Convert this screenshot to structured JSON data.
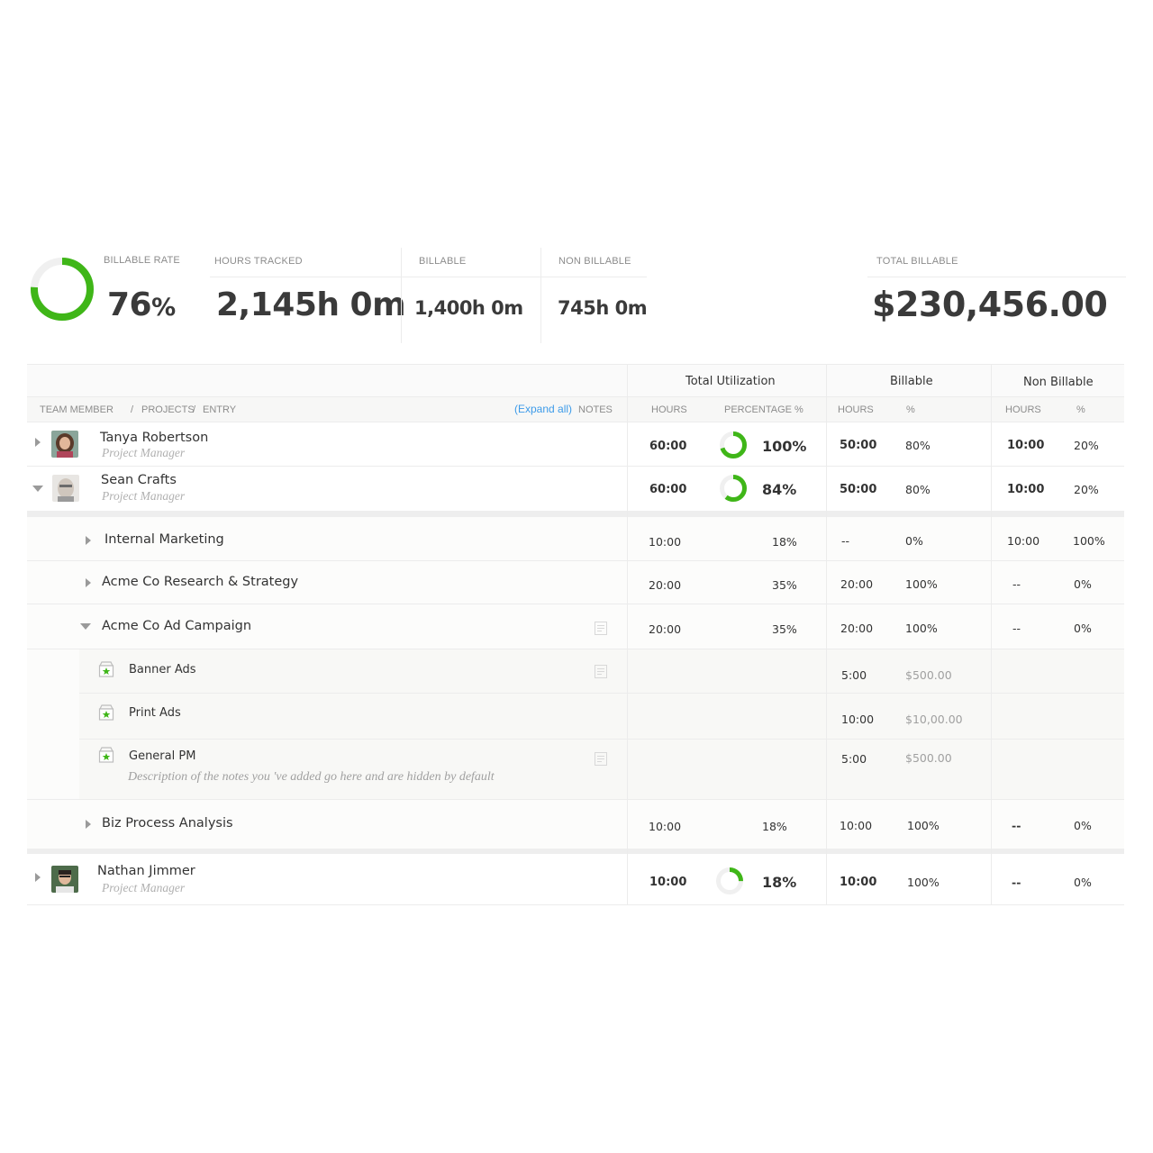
{
  "summary": {
    "billable_rate": {
      "label": "BILLABLE RATE",
      "value": "76",
      "unit": "%",
      "fraction": 0.76
    },
    "hours_tracked": {
      "label": "HOURS TRACKED",
      "value": "2,145h 0m"
    },
    "billable": {
      "label": "BILLABLE",
      "value": "1,400h 0m"
    },
    "non_billable": {
      "label": "NON BILLABLE",
      "value": "745h 0m"
    },
    "total_billable": {
      "label": "TOTAL BILLABLE",
      "value": "$230,456.00"
    }
  },
  "table": {
    "groups": {
      "total_utilization": "Total Utilization",
      "billable": "Billable",
      "non_billable": "Non Billable"
    },
    "columns": {
      "team_member": "TEAM MEMBER",
      "sep1": "/",
      "projects": "PROJECTS",
      "sep2": "/",
      "entry": "ENTRY",
      "expand_all": "(Expand all)",
      "notes": "NOTES",
      "tu_hours": "HOURS",
      "tu_percentage": "PERCENTAGE %",
      "b_hours": "HOURS",
      "b_pct": "%",
      "nb_hours": "HOURS",
      "nb_pct": "%"
    },
    "members": [
      {
        "name": "Tanya Robertson",
        "role": "Project Manager",
        "hours": "60:00",
        "pct": "100%",
        "pct_fraction": 1.0,
        "b_hours": "50:00",
        "b_pct": "80%",
        "nb_hours": "10:00",
        "nb_pct": "20%"
      },
      {
        "name": "Sean Crafts",
        "role": "Project Manager",
        "hours": "60:00",
        "pct": "84%",
        "pct_fraction": 0.84,
        "b_hours": "50:00",
        "b_pct": "80%",
        "nb_hours": "10:00",
        "nb_pct": "20%"
      },
      {
        "name": "Nathan Jimmer",
        "role": "Project Manager",
        "hours": "10:00",
        "pct": "18%",
        "pct_fraction": 0.18,
        "b_hours": "10:00",
        "b_pct": "100%",
        "nb_hours": "--",
        "nb_pct": "0%"
      }
    ],
    "projects": [
      {
        "name": "Internal Marketing",
        "hours": "10:00",
        "pct": "18%",
        "b_hours": "--",
        "b_pct": "0%",
        "nb_hours": "10:00",
        "nb_pct": "100%"
      },
      {
        "name": "Acme Co Research & Strategy",
        "hours": "20:00",
        "pct": "35%",
        "b_hours": "20:00",
        "b_pct": "100%",
        "nb_hours": "--",
        "nb_pct": "0%"
      },
      {
        "name": "Acme Co Ad Campaign",
        "hours": "20:00",
        "pct": "35%",
        "b_hours": "20:00",
        "b_pct": "100%",
        "nb_hours": "--",
        "nb_pct": "0%"
      },
      {
        "name": "Biz Process Analysis",
        "hours": "10:00",
        "pct": "18%",
        "b_hours": "10:00",
        "b_pct": "100%",
        "nb_hours": "--",
        "nb_pct": "0%"
      }
    ],
    "entries": [
      {
        "name": "Banner Ads",
        "b_hours": "5:00",
        "amount": "$500.00"
      },
      {
        "name": "Print Ads",
        "b_hours": "10:00",
        "amount": "$10,00.00"
      },
      {
        "name": "General PM",
        "b_hours": "5:00",
        "amount": "$500.00",
        "note": "Description of the notes you 've added go here and are hidden by default"
      }
    ]
  },
  "colors": {
    "accent_green": "#3fb618",
    "ring_track": "#f0f0f0",
    "link_blue": "#3d9be9"
  }
}
